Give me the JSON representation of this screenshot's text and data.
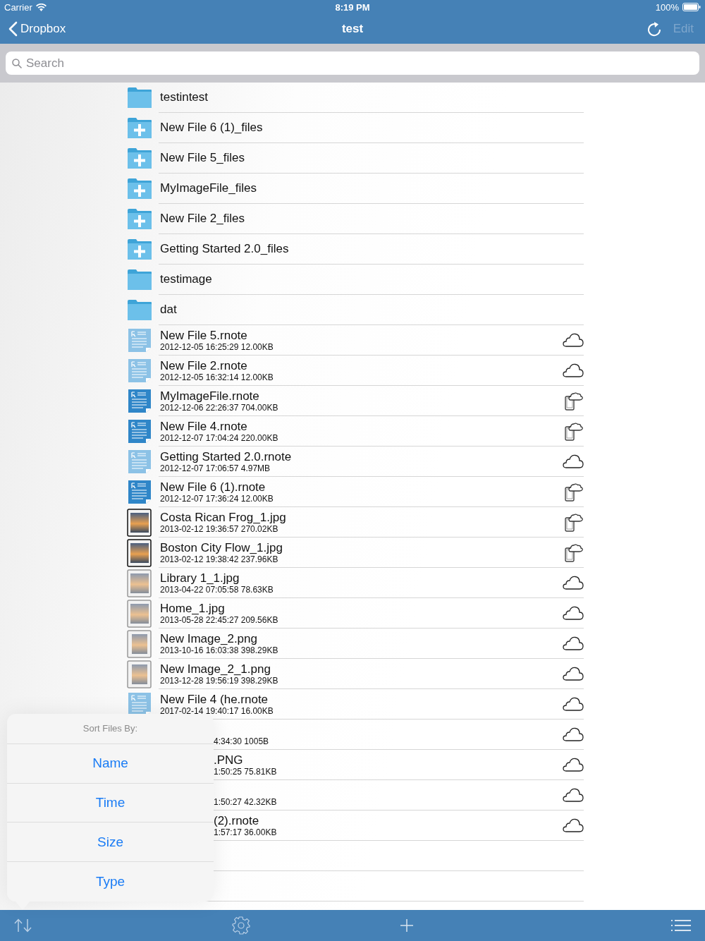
{
  "status_bar": {
    "carrier": "Carrier",
    "time": "8:19 PM",
    "battery": "100%"
  },
  "nav": {
    "back": "Dropbox",
    "title": "test",
    "edit": "Edit",
    "edit_disabled": true
  },
  "search": {
    "placeholder": "Search"
  },
  "items": [
    {
      "kind": "folder",
      "name": "testintest"
    },
    {
      "kind": "shared-folder",
      "name": "New File 6 (1)_files"
    },
    {
      "kind": "shared-folder",
      "name": "New File 5_files"
    },
    {
      "kind": "shared-folder",
      "name": "MyImageFile_files"
    },
    {
      "kind": "shared-folder",
      "name": "New File 2_files"
    },
    {
      "kind": "shared-folder",
      "name": "Getting Started 2.0_files"
    },
    {
      "kind": "folder",
      "name": "testimage"
    },
    {
      "kind": "folder",
      "name": "dat"
    },
    {
      "kind": "rnote",
      "name": "New File 5.rnote",
      "meta": "2012-12-05 16:25:29  12.00KB",
      "downloaded": false
    },
    {
      "kind": "rnote",
      "name": "New File 2.rnote",
      "meta": "2012-12-05 16:32:14  12.00KB",
      "downloaded": false
    },
    {
      "kind": "rnote",
      "name": "MyImageFile.rnote",
      "meta": "2012-12-06 22:26:37  704.00KB",
      "downloaded": true
    },
    {
      "kind": "rnote",
      "name": "New File 4.rnote",
      "meta": "2012-12-07 17:04:24  220.00KB",
      "downloaded": true
    },
    {
      "kind": "rnote",
      "name": "Getting Started 2.0.rnote",
      "meta": "2012-12-07 17:06:57  4.97MB",
      "downloaded": false
    },
    {
      "kind": "rnote",
      "name": "New File 6 (1).rnote",
      "meta": "2012-12-07 17:36:24  12.00KB",
      "downloaded": true
    },
    {
      "kind": "jpg",
      "name": "Costa Rican Frog_1.jpg",
      "meta": "2013-02-12 19:36:57  270.02KB",
      "downloaded": true
    },
    {
      "kind": "jpg",
      "name": "Boston City Flow_1.jpg",
      "meta": "2013-02-12 19:38:42  237.96KB",
      "downloaded": true
    },
    {
      "kind": "jpg",
      "name": "Library 1_1.jpg",
      "meta": "2013-04-22 07:05:58  78.63KB",
      "downloaded": false
    },
    {
      "kind": "jpg",
      "name": "Home_1.jpg",
      "meta": "2013-05-28 22:45:27  209.56KB",
      "downloaded": false
    },
    {
      "kind": "png",
      "name": "New Image_2.png",
      "meta": "2013-10-16 16:03:38  398.29KB",
      "downloaded": false
    },
    {
      "kind": "png",
      "name": "New Image_2_1.png",
      "meta": "2013-12-28 19:56:19  398.29KB",
      "downloaded": false
    },
    {
      "kind": "rnote",
      "name": "New File 4 (he.rnote",
      "meta": "2017-02-14 19:40:17  16.00KB",
      "downloaded": false
    }
  ],
  "hidden_rows": [
    {
      "meta": "4:34:30  1005B",
      "downloaded": false
    },
    {
      "name": ".PNG",
      "meta": "1:50:25  75.81KB",
      "downloaded": false
    },
    {
      "meta": "1:50:27  42.32KB",
      "downloaded": false
    },
    {
      "name": "(2).rnote",
      "meta": "1:57:17  36.00KB",
      "downloaded": false
    }
  ],
  "sort_menu": {
    "title": "Sort Files By:",
    "options": [
      "Name",
      "Time",
      "Size",
      "Type"
    ]
  }
}
